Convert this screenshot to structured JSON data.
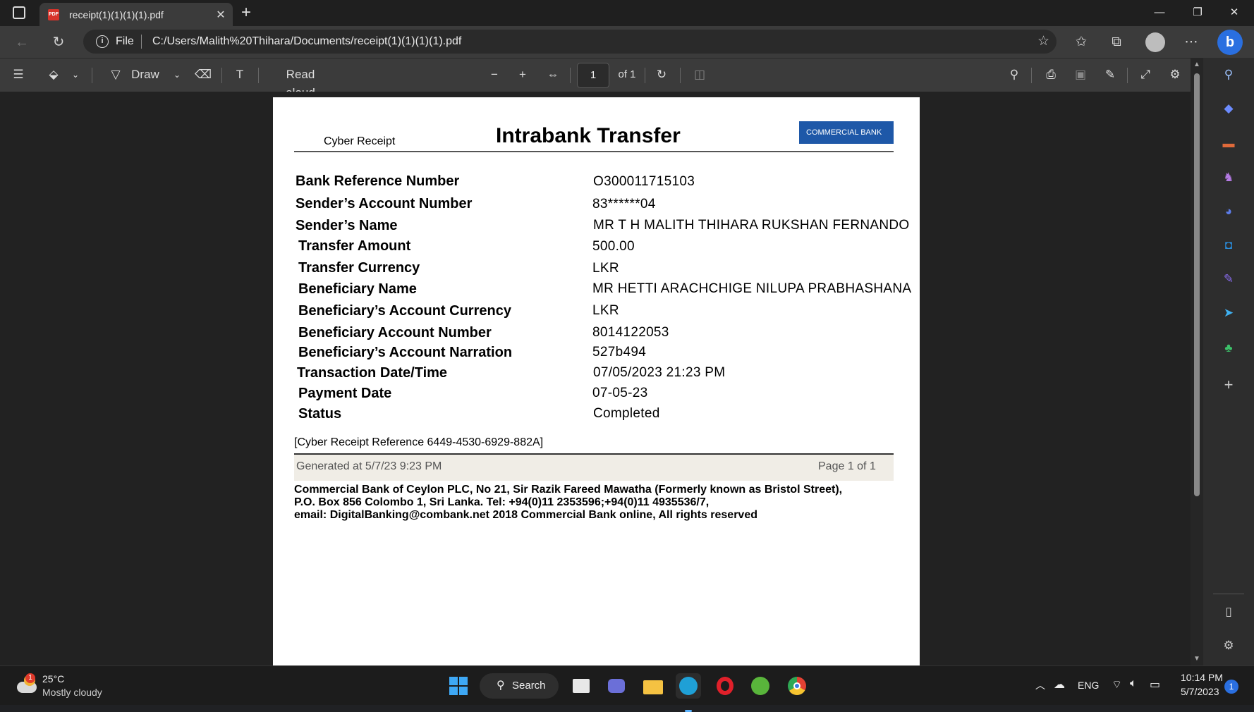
{
  "browser": {
    "tab_title": "receipt(1)(1)(1)(1).pdf",
    "tab_close": "✕",
    "new_tab": "+",
    "address_scheme": "File",
    "address_url": "C:/Users/Malith%20Thihara/Documents/receipt(1)(1)(1)(1).pdf"
  },
  "pdf_toolbar": {
    "draw_label": "Draw",
    "read_aloud_label": "Read aloud",
    "page_number": "1",
    "page_total": "of 1"
  },
  "receipt": {
    "header_left": "Cyber Receipt",
    "title": "Intrabank Transfer",
    "bank_logo_text": "COMMERCIAL BANK",
    "fields": [
      {
        "label": "Bank Reference Number",
        "value": "O300011715103"
      },
      {
        "label": "Sender’s Account Number",
        "value": "83******04"
      },
      {
        "label": "Sender’s Name",
        "value": "MR T H MALITH THIHARA RUKSHAN FERNANDO"
      },
      {
        "label": "Transfer Amount",
        "value": "500.00"
      },
      {
        "label": "Transfer Currency",
        "value": "LKR"
      },
      {
        "label": "Beneficiary Name",
        "value": "MR HETTI ARACHCHIGE NILUPA PRABHASHANA"
      },
      {
        "label": "Beneficiary’s Account Currency",
        "value": "LKR"
      },
      {
        "label": "Beneficiary Account Number",
        "value": "8014122053"
      },
      {
        "label": "Beneficiary’s Account Narration",
        "value": "527b494"
      },
      {
        "label": "Transaction Date/Time",
        "value": "07/05/2023 21:23 PM"
      },
      {
        "label": "Payment Date",
        "value": "07-05-23"
      },
      {
        "label": "Status",
        "value": "Completed"
      }
    ],
    "reference": "[Cyber Receipt Reference 6449-4530-6929-882A]",
    "generated": "Generated at 5/7/23 9:23 PM",
    "page_of": "Page 1 of 1",
    "footer_lines": [
      "Commercial Bank of Ceylon PLC, No 21, Sir Razik Fareed Mawatha (Formerly known as Bristol Street),",
      "P.O. Box 856 Colombo 1, Sri Lanka. Tel: +94(0)11 2353596;+94(0)11 4935536/7,",
      "email: DigitalBanking@combank.net 2018 Commercial Bank online, All rights reserved"
    ]
  },
  "taskbar": {
    "weather_temp": "25°C",
    "weather_desc": "Mostly cloudy",
    "weather_badge": "1",
    "search_label": "Search",
    "language": "ENG",
    "time": "10:14 PM",
    "date": "5/7/2023",
    "notification_count": "1"
  },
  "colors": {
    "accent": "#2a6fe0",
    "bank_blue": "#1e58a8",
    "pdf_red": "#d7342b"
  }
}
